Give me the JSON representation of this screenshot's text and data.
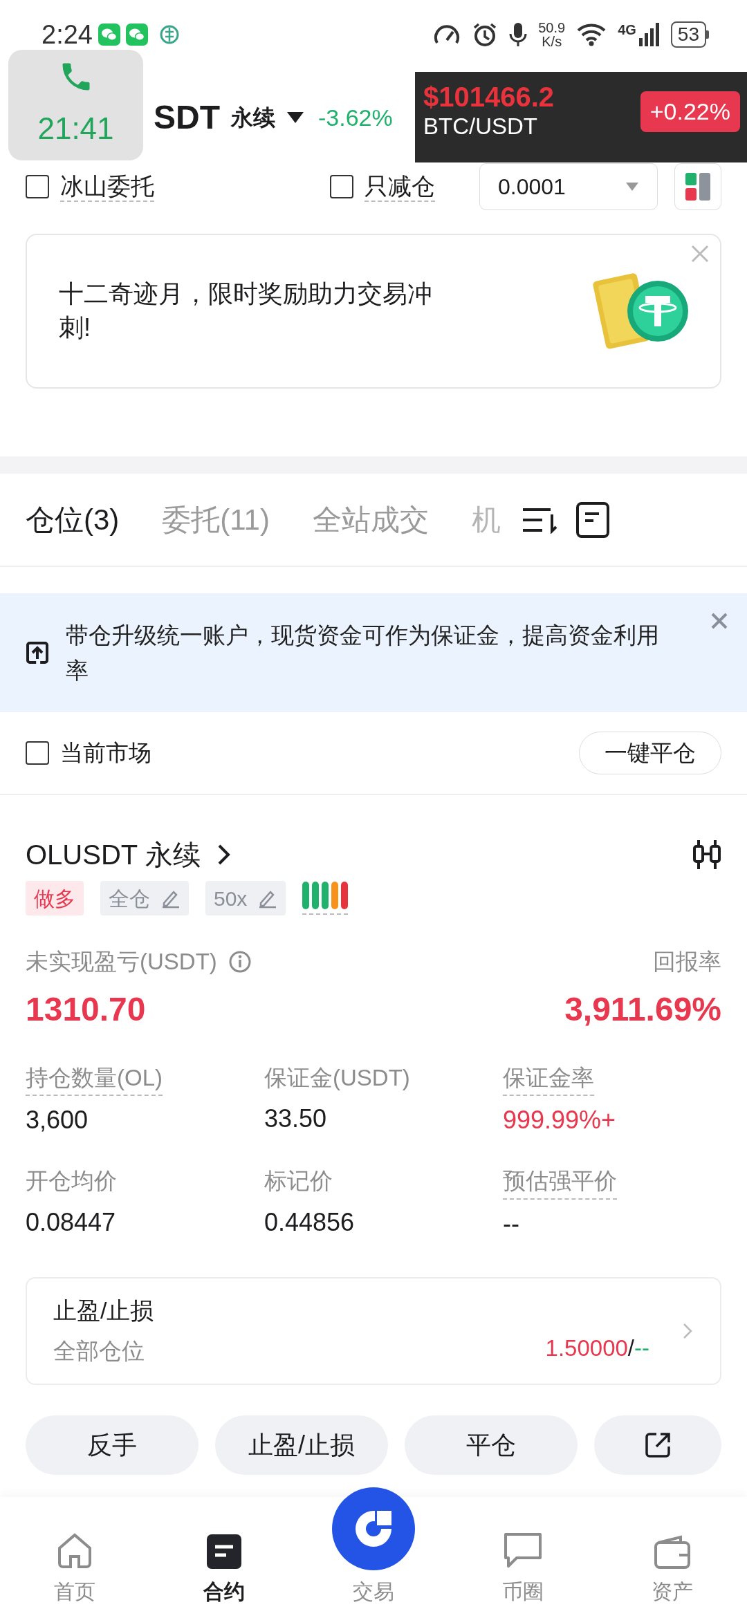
{
  "status_bar": {
    "time": "2:24",
    "net_speed": "50.9",
    "net_unit": "K/s",
    "network": "4G",
    "battery": "53"
  },
  "call_widget": {
    "duration": "21:41"
  },
  "header": {
    "symbol": "SDT",
    "contract_type": "永续",
    "change": "-3.62%"
  },
  "price_overlay": {
    "price": "$101466.2",
    "pair": "BTC/USDT",
    "change": "+0.22%"
  },
  "order_options": [
    {
      "label": "冰山委托",
      "checked": false
    },
    {
      "label": "只减仓",
      "checked": false
    }
  ],
  "quantity_select": {
    "value": "0.0001"
  },
  "promo": {
    "text": "十二奇迹月，限时奖励助力交易冲刺!"
  },
  "tabs": [
    {
      "label": "仓位(3)",
      "selected": true
    },
    {
      "label": "委托(11)",
      "selected": false
    },
    {
      "label": "全站成交",
      "selected": false
    },
    {
      "label": "机",
      "selected": false
    }
  ],
  "notice": {
    "text": "带仓升级统一账户，现货资金可作为保证金，提高资金利用率"
  },
  "filter": {
    "label": "当前市场",
    "checked": false
  },
  "close_all_button": "一键平仓",
  "position": {
    "symbol": "OLUSDT 永续",
    "side": "做多",
    "margin_mode": "全仓",
    "leverage": "50x",
    "risk_bars": [
      {
        "color": "#20b26c"
      },
      {
        "color": "#20b26c"
      },
      {
        "color": "#20b26c"
      },
      {
        "color": "#f7931a"
      },
      {
        "color": "#e8333d"
      }
    ],
    "pnl_label": "未实现盈亏(USDT)",
    "pnl": "1310.70",
    "roe_label": "回报率",
    "roe": "3,911.69%",
    "stats": [
      {
        "label": "持仓数量(OL)",
        "value": "3,600",
        "underlined": true,
        "highlight": false
      },
      {
        "label": "保证金(USDT)",
        "value": "33.50",
        "underlined": false,
        "highlight": false
      },
      {
        "label": "保证金率",
        "value": "999.99%+",
        "underlined": true,
        "highlight": true
      },
      {
        "label": "开仓均价",
        "value": "0.08447",
        "underlined": false,
        "highlight": false
      },
      {
        "label": "标记价",
        "value": "0.44856",
        "underlined": false,
        "highlight": false
      },
      {
        "label": "预估强平价",
        "value": "--",
        "underlined": true,
        "highlight": false
      }
    ]
  },
  "tpsl": {
    "title": "止盈/止损",
    "scope": "全部仓位",
    "take_profit": "1.50000",
    "separator": "/",
    "stop_loss": "--"
  },
  "actions": [
    {
      "kind": "text",
      "label": "反手"
    },
    {
      "kind": "text",
      "label": "止盈/止损"
    },
    {
      "kind": "text",
      "label": "平仓"
    },
    {
      "kind": "share"
    }
  ],
  "bottom_nav": [
    {
      "kind": "home",
      "label": "首页",
      "selected": false
    },
    {
      "kind": "contract",
      "label": "合约",
      "selected": true
    },
    {
      "kind": "trade",
      "label": "交易",
      "selected": false
    },
    {
      "kind": "community",
      "label": "币圈",
      "selected": false
    },
    {
      "kind": "assets",
      "label": "资产",
      "selected": false
    }
  ]
}
